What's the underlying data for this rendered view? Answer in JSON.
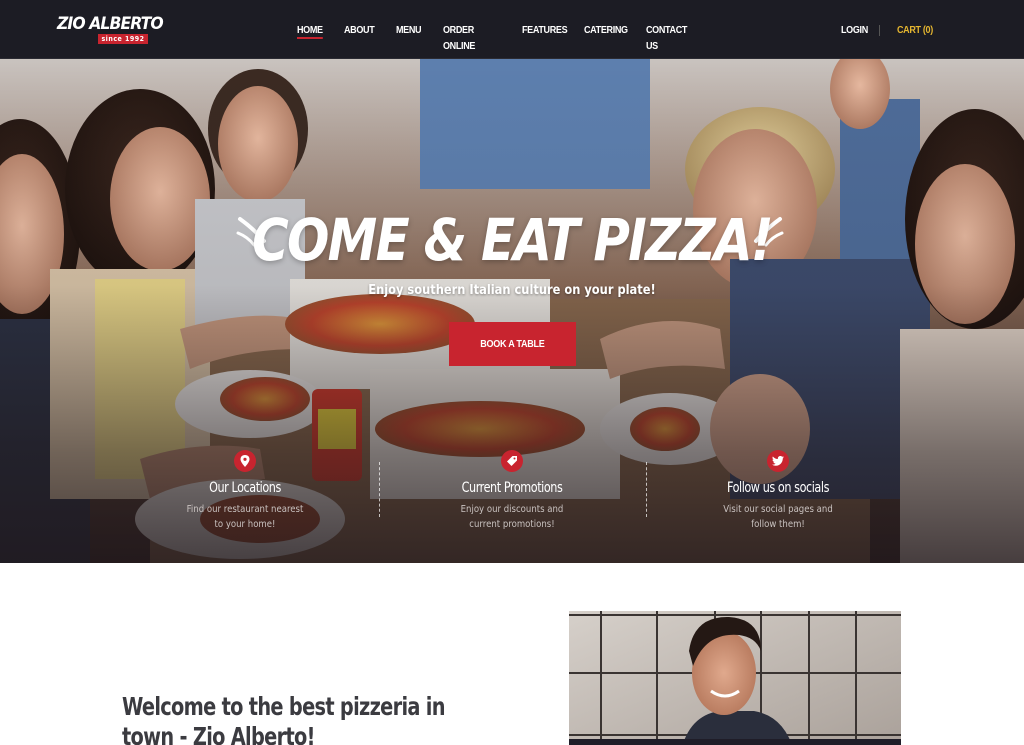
{
  "brand": {
    "name": "ZIO ALBERTO",
    "tagline": "since 1992",
    "accent_color": "#c8242f",
    "cart_color": "#e5b630"
  },
  "nav": {
    "items": [
      {
        "label": "Home",
        "active": true
      },
      {
        "label": "About",
        "active": false
      },
      {
        "label": "Menu",
        "active": false
      },
      {
        "label": "Order Online",
        "active": false
      },
      {
        "label": "Features",
        "active": false
      },
      {
        "label": "Catering",
        "active": false
      },
      {
        "label": "Contact Us",
        "active": false
      }
    ],
    "login_label": "Login",
    "cart_label": "Cart (0)"
  },
  "hero": {
    "title": "COME & EAT PIZZA!",
    "subtitle": "Enjoy southern Italian culture on your plate!",
    "cta_label": "Book a Table",
    "background_image": "friends-eating-pizza-photo"
  },
  "features": [
    {
      "icon": "map-pin-icon",
      "title": "Our Locations",
      "desc": [
        "Find our restaurant nearest",
        "to your home!"
      ]
    },
    {
      "icon": "tag-icon",
      "title": "Current Promotions",
      "desc": [
        "Enjoy our discounts and",
        "current promotions!"
      ]
    },
    {
      "icon": "twitter-icon",
      "title": "Follow us on socials",
      "desc": [
        "Visit our social pages and",
        "follow them!"
      ]
    }
  ],
  "welcome": {
    "title": "Welcome to the best pizzeria in town - Zio Alberto!",
    "image": "smiling-chef-photo"
  }
}
